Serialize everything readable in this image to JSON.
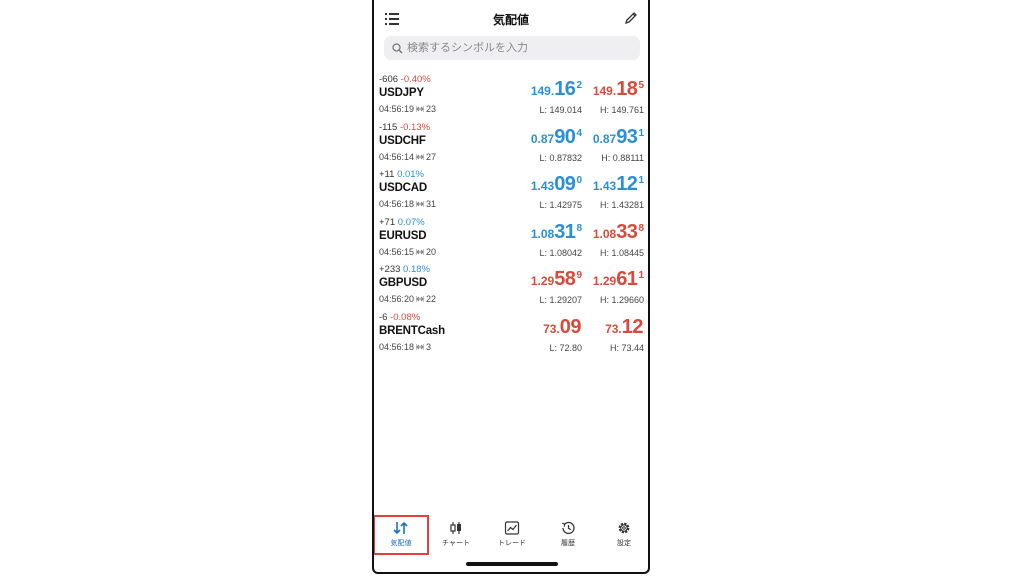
{
  "header": {
    "title": "気配値",
    "left_icon": "list-icon",
    "right_icon": "pencil-icon"
  },
  "search": {
    "placeholder": "検索するシンボルを入力",
    "value": "",
    "icon": "search-icon"
  },
  "quotes": [
    {
      "change_points": "-606",
      "change_pct": "-0.40%",
      "symbol": "USDJPY",
      "time": "04:56:19",
      "spread": "23",
      "bid": {
        "small": "149.",
        "big": "16",
        "sup": "2",
        "color": "#2b8fd6"
      },
      "ask": {
        "small": "149.",
        "big": "18",
        "sup": "5",
        "color": "#d94a3c"
      },
      "low": "L: 149.014",
      "high": "H: 149.761"
    },
    {
      "change_points": "-115",
      "change_pct": "-0.13%",
      "symbol": "USDCHF",
      "time": "04:56:14",
      "spread": "27",
      "bid": {
        "small": "0.87",
        "big": "90",
        "sup": "4",
        "color": "#2b8fd6"
      },
      "ask": {
        "small": "0.87",
        "big": "93",
        "sup": "1",
        "color": "#2b8fd6"
      },
      "low": "L: 0.87832",
      "high": "H: 0.88111"
    },
    {
      "change_points": "+11",
      "change_pct": "0.01%",
      "symbol": "USDCAD",
      "time": "04:56:18",
      "spread": "31",
      "bid": {
        "small": "1.43",
        "big": "09",
        "sup": "0",
        "color": "#2b8fd6"
      },
      "ask": {
        "small": "1.43",
        "big": "12",
        "sup": "1",
        "color": "#2b8fd6"
      },
      "low": "L: 1.42975",
      "high": "H: 1.43281"
    },
    {
      "change_points": "+71",
      "change_pct": "0.07%",
      "symbol": "EURUSD",
      "time": "04:56:15",
      "spread": "20",
      "bid": {
        "small": "1.08",
        "big": "31",
        "sup": "8",
        "color": "#2b8fd6"
      },
      "ask": {
        "small": "1.08",
        "big": "33",
        "sup": "8",
        "color": "#d94a3c"
      },
      "low": "L: 1.08042",
      "high": "H: 1.08445"
    },
    {
      "change_points": "+233",
      "change_pct": "0.18%",
      "symbol": "GBPUSD",
      "time": "04:56:20",
      "spread": "22",
      "bid": {
        "small": "1.29",
        "big": "58",
        "sup": "9",
        "color": "#d94a3c"
      },
      "ask": {
        "small": "1.29",
        "big": "61",
        "sup": "1",
        "color": "#d94a3c"
      },
      "low": "L: 1.29207",
      "high": "H: 1.29660"
    },
    {
      "change_points": "-6",
      "change_pct": "-0.08%",
      "symbol": "BRENTCash",
      "time": "04:56:18",
      "spread": "3",
      "bid": {
        "small": "73.",
        "big": "09",
        "sup": "",
        "color": "#d94a3c"
      },
      "ask": {
        "small": "73.",
        "big": "12",
        "sup": "",
        "color": "#d94a3c"
      },
      "low": "L: 72.80",
      "high": "H: 73.44"
    }
  ],
  "tabs": [
    {
      "label": "気配値",
      "icon": "quotes-arrows-icon",
      "active": true
    },
    {
      "label": "チャート",
      "icon": "chart-candles-icon",
      "active": false
    },
    {
      "label": "トレード",
      "icon": "trade-chart-icon",
      "active": false
    },
    {
      "label": "履歴",
      "icon": "history-clock-icon",
      "active": false
    },
    {
      "label": "設定",
      "icon": "settings-gear-icon",
      "active": false
    }
  ],
  "colors": {
    "bid_blue": "#2b8fd6",
    "ask_red": "#d94a3c",
    "active_tab": "#1f6fc4",
    "highlight": "#e0413a"
  }
}
